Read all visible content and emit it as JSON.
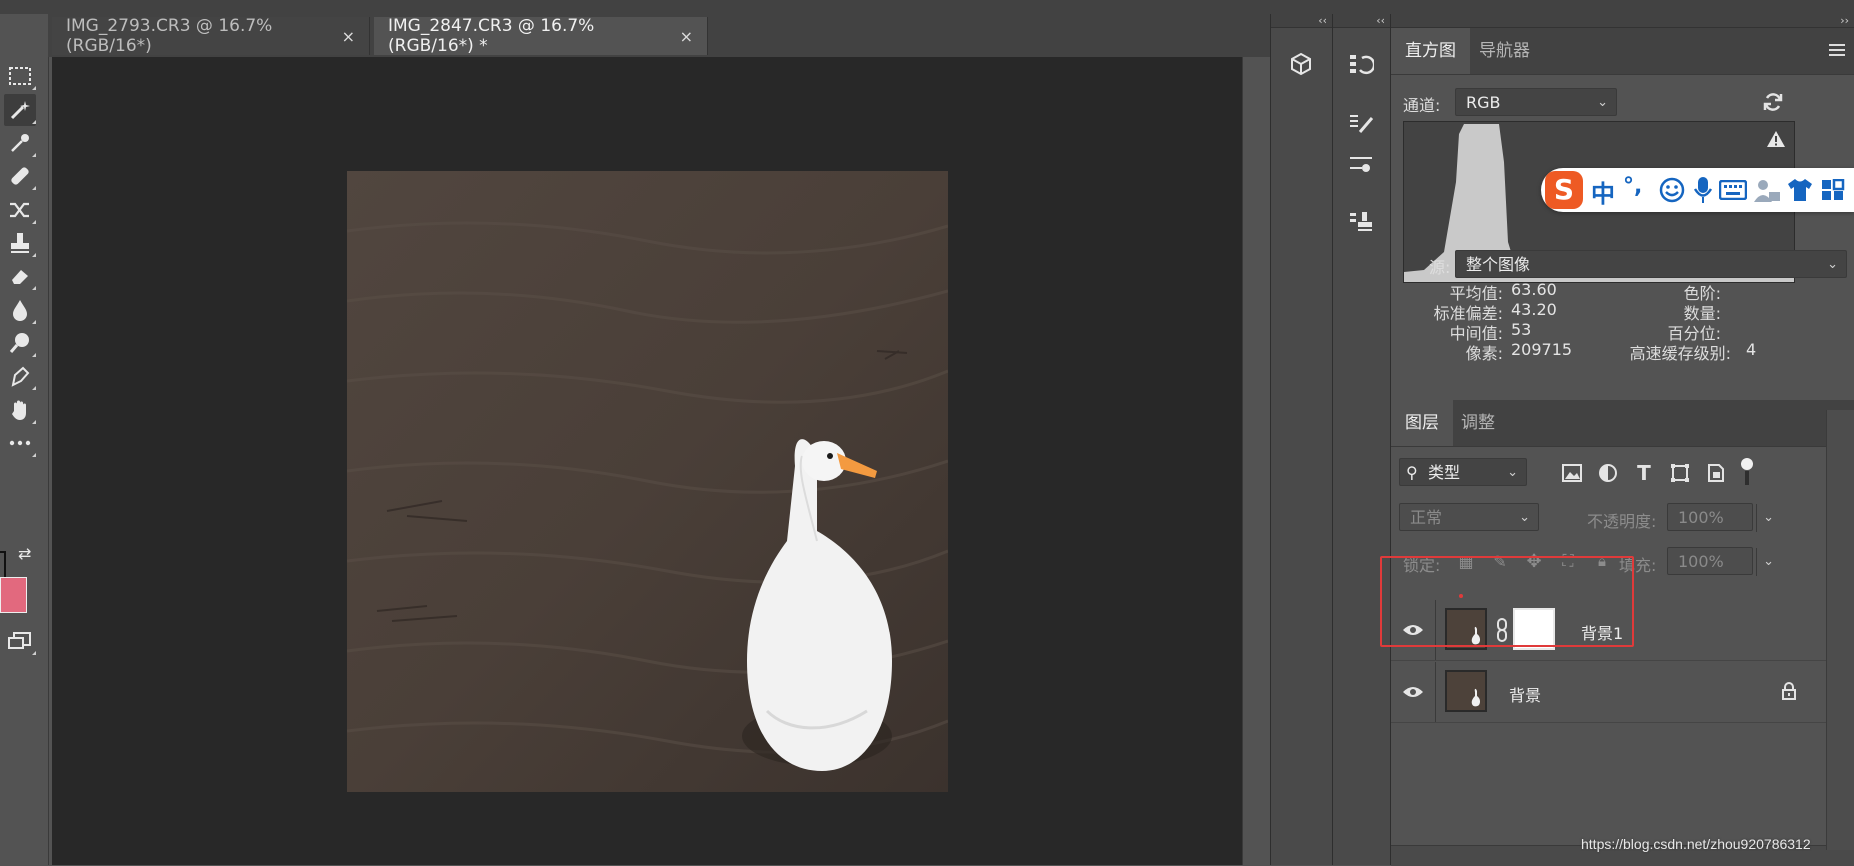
{
  "tabs": [
    {
      "label": "IMG_2793.CR3 @ 16.7%(RGB/16*)",
      "close": "×"
    },
    {
      "label": "IMG_2847.CR3 @ 16.7%(RGB/16*) *",
      "close": "×"
    }
  ],
  "histogram": {
    "tabs": [
      "直方图",
      "导航器"
    ],
    "channel_label": "通道:",
    "channel_value": "RGB",
    "source_label": "源:",
    "source_value": "整个图像",
    "stats_left": [
      {
        "k": "平均值:",
        "v": "63.60"
      },
      {
        "k": "标准偏差:",
        "v": "43.20"
      },
      {
        "k": "中间值:",
        "v": "53"
      },
      {
        "k": "像素:",
        "v": "209715"
      }
    ],
    "stats_right": [
      {
        "k": "色阶:",
        "v": ""
      },
      {
        "k": "数量:",
        "v": ""
      },
      {
        "k": "百分位:",
        "v": ""
      },
      {
        "k": "高速缓存级别:",
        "v": "4"
      }
    ]
  },
  "layers": {
    "tabs": [
      "图层",
      "调整"
    ],
    "filter_value": "类型",
    "blend_mode": "正常",
    "opacity_label": "不透明度:",
    "opacity_value": "100%",
    "lock_label": "锁定:",
    "fill_label": "填充:",
    "fill_value": "100%",
    "rows": [
      {
        "name": "背景1"
      },
      {
        "name": "背景"
      }
    ]
  },
  "ime": {
    "label": "中",
    "punct": "°,"
  },
  "watermark": "https://blog.csdn.net/zhou920786312",
  "colors": {
    "foreground": "#e2697e",
    "background": "#ffffff",
    "highlight": "#e03a3a"
  },
  "toolbar_icons": [
    "marquee-icon",
    "magic-wand-icon",
    "eyedropper-icon",
    "healing-brush-icon",
    "shuffle-icon",
    "stamp-icon",
    "eraser-icon",
    "blur-drop-icon",
    "dodge-icon",
    "pen-icon",
    "hand-icon",
    "more-icon"
  ]
}
